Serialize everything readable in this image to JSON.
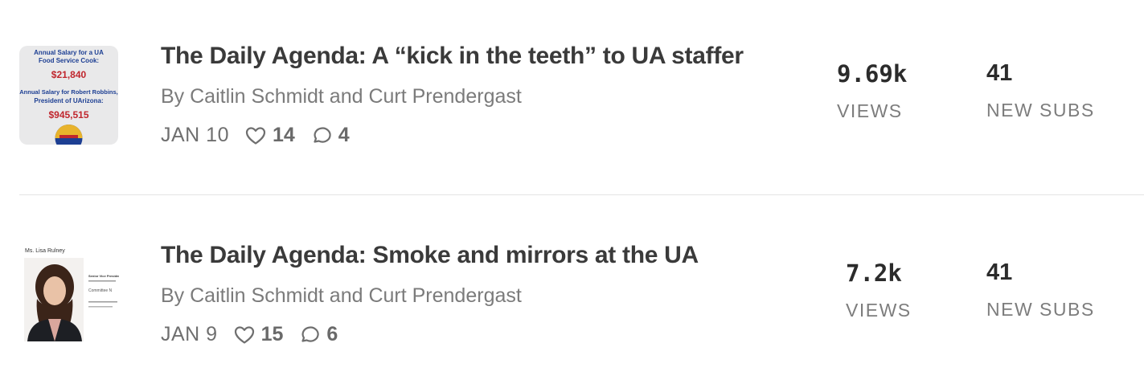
{
  "posts": [
    {
      "title": "The Daily Agenda: A “kick in the teeth” to UA staffer",
      "byline": "By Caitlin Schmidt and Curt Prendergast",
      "date": "JAN 10",
      "likes": "14",
      "comments": "4",
      "views": "9.69k",
      "views_label": "VIEWS",
      "subs": "41",
      "subs_label": "NEW SUBS",
      "thumb": {
        "line1": "Annual Salary for a UA",
        "line2": "Food Service Cook:",
        "amount1": "$21,840",
        "line3": "Annual Salary for Robert Robbins,",
        "line4": "President of UArizona:",
        "amount2": "$945,515"
      }
    },
    {
      "title": "The Daily Agenda: Smoke and mirrors at the UA",
      "byline": "By Caitlin Schmidt and Curt Prendergast",
      "date": "JAN 9",
      "likes": "15",
      "comments": "6",
      "views": "7.2k",
      "views_label": "VIEWS",
      "subs": "41",
      "subs_label": "NEW SUBS",
      "thumb": {
        "name": "Ms. Lisa Rulney",
        "role": "Senior Vice President",
        "committee": "Committee N"
      }
    }
  ],
  "colors": {
    "red": "#c0262d",
    "navy": "#1d3f93",
    "thumb_bg": "#e9e9ea"
  },
  "icons": {
    "like": "heart-icon",
    "comment": "comment-icon"
  }
}
